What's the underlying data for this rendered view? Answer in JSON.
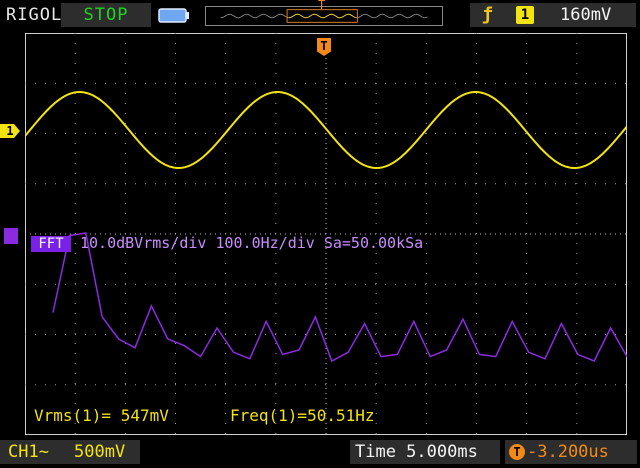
{
  "top": {
    "brand": "RIGOL",
    "run_state": "STOP",
    "trigger_edge_icon": "rising-edge-icon",
    "trigger_source": "1",
    "trigger_level": "160mV",
    "trigger_marker": "T"
  },
  "channels": {
    "ch1_marker": "1",
    "ch1_label": "CH1~",
    "ch1_scale": "500mV"
  },
  "fft": {
    "tag": "FFT",
    "info": "10.0dBVrms/div 100.0Hz/div Sa=50.00kSa"
  },
  "measurements": {
    "vrms": "Vrms(1)= 547mV",
    "freq": "Freq(1)=50.51Hz"
  },
  "timebase": {
    "time": "Time 5.000ms",
    "offset": "-3.200us"
  },
  "colors": {
    "ch1": "#f2e312",
    "math": "#8a2be2",
    "trigger": "#f28a1a",
    "run": "#21d321"
  },
  "chart_data": [
    {
      "type": "line",
      "values": [
        0.0,
        0.59,
        0.95,
        0.95,
        0.59,
        0.0,
        -0.59,
        -0.95,
        -0.95,
        -0.59,
        0.0
      ]
    },
    {
      "type": "line",
      "values": [
        -28,
        7,
        31,
        -30,
        -40,
        -44,
        -25,
        -40,
        -43,
        -48,
        -35,
        -46,
        -49,
        -32,
        -47,
        -45,
        -30,
        -50,
        -46,
        -33,
        -48,
        -47,
        -32,
        -48,
        -45,
        -31,
        -47,
        -48,
        -32,
        -46,
        -49,
        -33,
        -47,
        -50,
        -35,
        -48
      ]
    }
  ]
}
